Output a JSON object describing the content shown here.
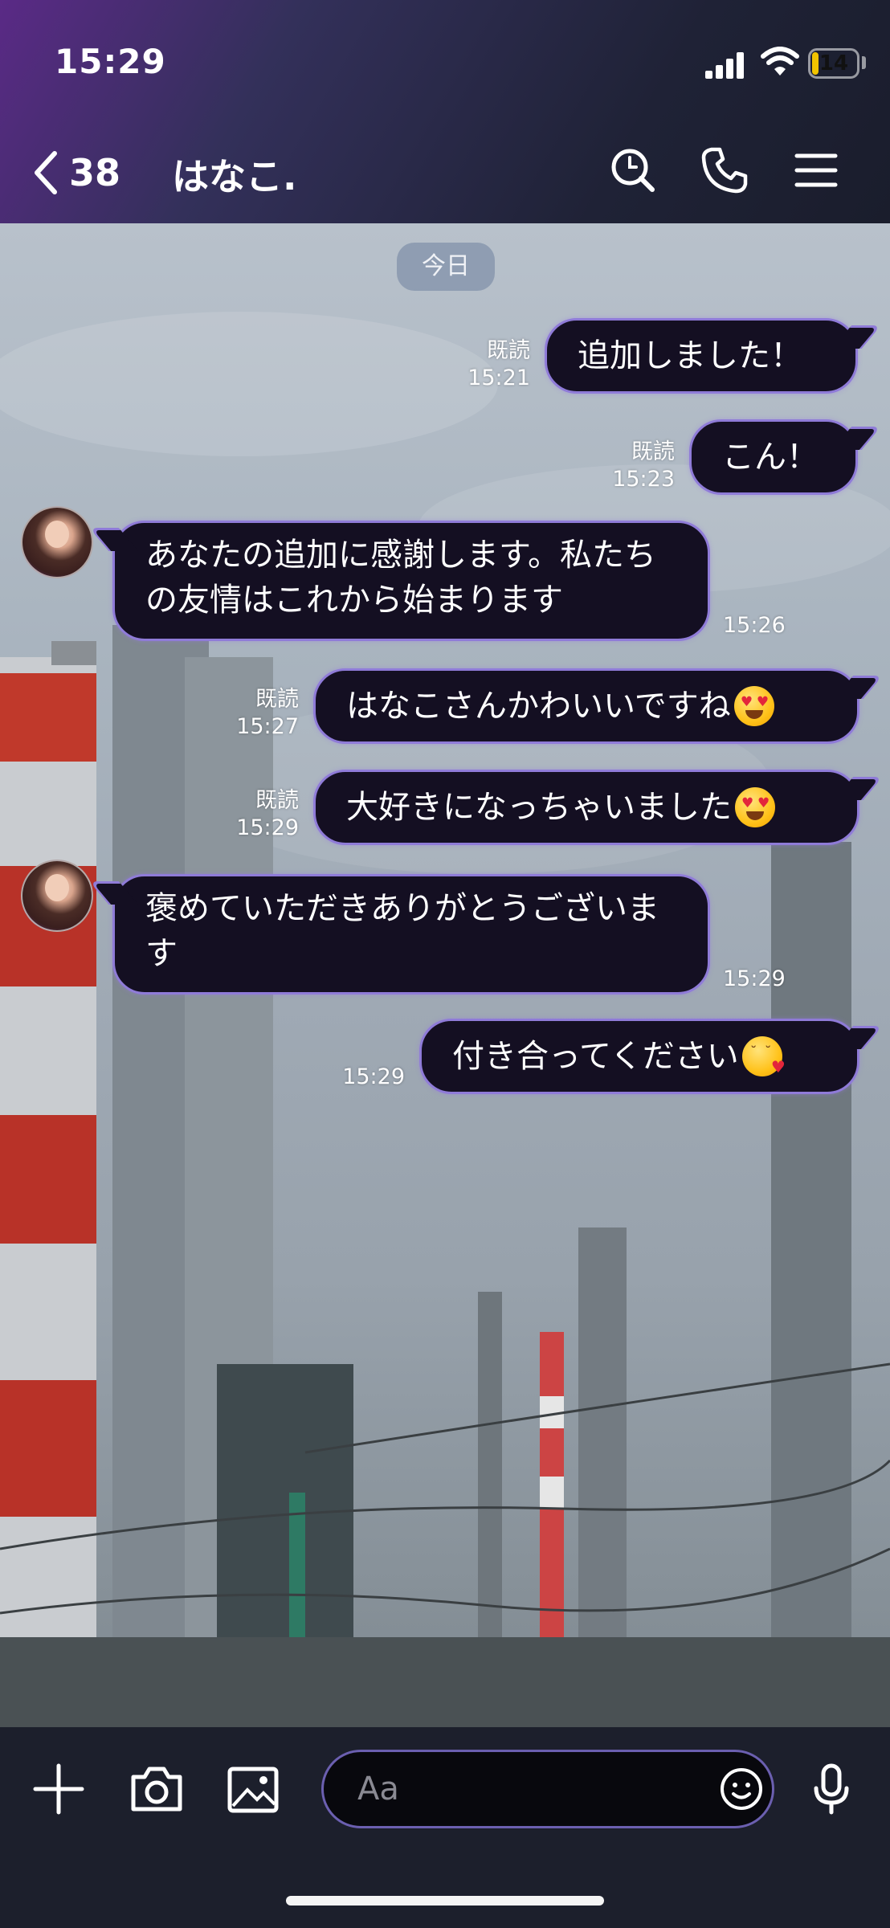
{
  "status_bar": {
    "time": "15:29",
    "battery": "14",
    "battery_level": 0.14
  },
  "header": {
    "back_count": "38",
    "title": "はなこ."
  },
  "chat": {
    "date_label": "今日",
    "messages": [
      {
        "side": "right",
        "text": "追加しました！",
        "read": "既読",
        "time": "15:21"
      },
      {
        "side": "right",
        "text": "こん！",
        "read": "既読",
        "time": "15:23"
      },
      {
        "side": "left",
        "text": "あなたの追加に感謝します。私たちの友情はこれから始まります",
        "time": "15:26"
      },
      {
        "side": "right",
        "text": "はなこさんかわいいですね",
        "emoji": "heart-eyes-emoji",
        "read": "既読",
        "time": "15:27"
      },
      {
        "side": "right",
        "text": "大好きになっちゃいました",
        "emoji": "heart-eyes-emoji",
        "read": "既読",
        "time": "15:29"
      },
      {
        "side": "left",
        "text": "褒めていただきありがとうございます",
        "time": "15:29"
      },
      {
        "side": "right",
        "text": "付き合ってください",
        "emoji": "kissing-heart-emoji",
        "time": "15:29"
      }
    ]
  },
  "input": {
    "placeholder": "Aa"
  },
  "colors": {
    "bubble_bg": "#140f22",
    "bubble_border": "#8f7bd8",
    "input_border": "#6b5fb0"
  }
}
